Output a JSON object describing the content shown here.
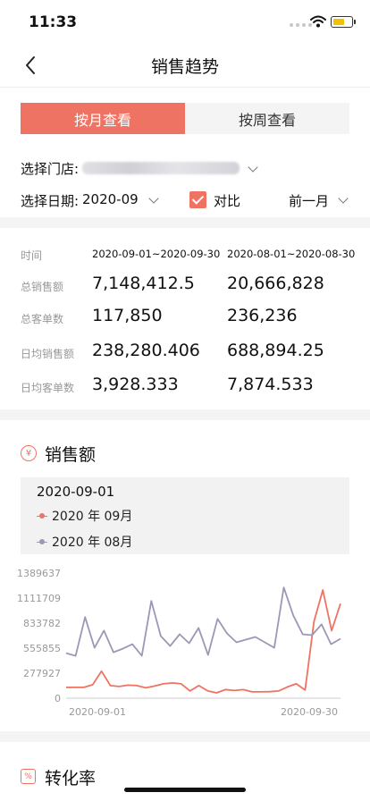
{
  "status": {
    "time": "11:33"
  },
  "nav": {
    "title": "销售趋势",
    "back_icon": "chevron-left-icon"
  },
  "tabs": [
    {
      "label": "按月查看",
      "active": true
    },
    {
      "label": "按周查看",
      "active": false
    }
  ],
  "filters": {
    "store_label": "选择门店:",
    "date_label": "选择日期:",
    "date_value": "2020-09",
    "compare_label": "对比",
    "compare_checked": true,
    "period_value": "前一月"
  },
  "stats": {
    "header_label": "时间",
    "range_current": "2020-09-01~2020-09-30",
    "range_previous": "2020-08-01~2020-08-30",
    "rows": [
      {
        "label": "总销售额",
        "current": "7,148,412.5",
        "previous": "20,666,828"
      },
      {
        "label": "总客单数",
        "current": "117,850",
        "previous": "236,236"
      },
      {
        "label": "日均销售额",
        "current": "238,280.406",
        "previous": "688,894.25"
      },
      {
        "label": "日均客单数",
        "current": "3,928.333",
        "previous": "7,874.533"
      }
    ]
  },
  "sales_section": {
    "title": "销售额",
    "icon": "yen-circle-icon",
    "tooltip": {
      "date": "2020-09-01",
      "legend": [
        {
          "label": "2020 年 09月",
          "color": "#ef7363"
        },
        {
          "label": "2020 年 08月",
          "color": "#9b98b6"
        }
      ]
    }
  },
  "conversion_section": {
    "title": "转化率",
    "icon": "conversion-icon"
  },
  "colors": {
    "accent": "#ef7363",
    "compare": "#9b98b6",
    "gap": "#f4f4f4"
  },
  "chart_data": {
    "type": "line",
    "y_ticks": [
      "0",
      "277927",
      "555855",
      "833782",
      "1111709",
      "1389637"
    ],
    "ylim": [
      0,
      1389637
    ],
    "x_tick_labels": [
      "2020-09-01",
      "2020-09-30"
    ],
    "grid": false,
    "series": [
      {
        "name": "2020 年 09月",
        "color": "#ef7363",
        "values": [
          120000,
          120000,
          120000,
          150000,
          300000,
          140000,
          130000,
          145000,
          140000,
          115000,
          135000,
          160000,
          170000,
          160000,
          80000,
          140000,
          80000,
          60000,
          95000,
          85000,
          95000,
          70000,
          70000,
          72000,
          80000,
          125000,
          160000,
          90000,
          850000,
          1200000,
          750000,
          1050000
        ]
      },
      {
        "name": "2020 年 08月",
        "color": "#9b98b6",
        "values": [
          500000,
          470000,
          900000,
          560000,
          750000,
          510000,
          550000,
          600000,
          470000,
          1080000,
          690000,
          580000,
          710000,
          610000,
          780000,
          480000,
          880000,
          720000,
          620000,
          650000,
          680000,
          620000,
          560000,
          1230000,
          920000,
          710000,
          700000,
          820000,
          600000,
          660000
        ]
      }
    ]
  }
}
